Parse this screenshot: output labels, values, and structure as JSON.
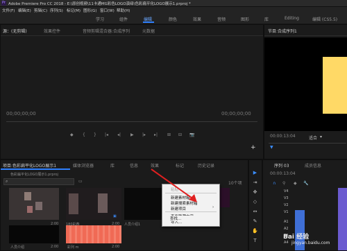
{
  "app": {
    "logo": "Pr",
    "title": "Adobe Premiere Pro CC 2018 - E:\\原创视频\\11卡通MG彩色LOGO演绎\\色彩扁平化LOGO展示1.prproj *"
  },
  "menu": [
    "文件(F)",
    "编辑(E)",
    "剪辑(C)",
    "序列(S)",
    "标记(M)",
    "图形(G)",
    "窗口(W)",
    "帮助(H)"
  ],
  "workspaces": [
    "学习",
    "组件",
    "编辑",
    "颜色",
    "效果",
    "音频",
    "图形",
    "库",
    "Editing",
    "编辑 (CS5.5)"
  ],
  "active_workspace": "编辑",
  "source_panel": {
    "tabs": [
      "源：(无剪辑)",
      "效果控件",
      "音频剪辑混合器:合成序列",
      "元数据"
    ],
    "timecode_left": "00;00;00;00",
    "timecode_right": "00;00;00;00",
    "transport": [
      "◆",
      "{",
      "}",
      "|◂",
      "◂|",
      "▶",
      "|▸",
      "▸|",
      "⊞",
      "⊟",
      "📷"
    ]
  },
  "program_panel": {
    "tab": "节目:合成序列1",
    "timecode": "00:00:13:04",
    "fit_label": "适合"
  },
  "project_panel": {
    "tabs": [
      "项目:色彩扁平化LOGO展示1",
      "媒体浏览器",
      "库",
      "信息",
      "效果",
      "标记",
      "历史记录"
    ],
    "file": "色彩扁平化LOGO展示1.prproj",
    "search_placeholder": "",
    "item_count": "10个项",
    "items": [
      {
        "name": "",
        "duration": "2:00"
      },
      {
        "name": "180彩春",
        "duration": "2:00"
      },
      {
        "name": "人员介绍1",
        "duration": ""
      },
      {
        "name": "",
        "duration": ""
      },
      {
        "name": "人员介绍",
        "duration": "2:00"
      },
      {
        "name": "彩列 m",
        "duration": "2:00"
      }
    ]
  },
  "context_menu": {
    "header": "粘贴",
    "items": [
      "新建素材箱",
      "新建搜索素材箱",
      "新建项目",
      "查看隐藏内容",
      "导入...",
      "查找..."
    ],
    "submenu_arrow": "›"
  },
  "tools": [
    "▶",
    "⇥",
    "✥",
    "◇",
    "↔",
    "✎",
    "✋",
    "T"
  ],
  "timeline": {
    "tab": "序列 03",
    "tab2": "成员信息",
    "timecode": "00:00:13:04",
    "tracks": [
      "V4",
      "V3",
      "V2",
      "V1",
      "A1",
      "A2",
      "A3",
      "A4"
    ]
  },
  "watermark": {
    "text": "Bai 经验",
    "url": "jingyan.baidu.com"
  },
  "colors": {
    "accent": "#2f80ff",
    "timecode": "#3b8dff",
    "program_preview": "#ffd966"
  }
}
